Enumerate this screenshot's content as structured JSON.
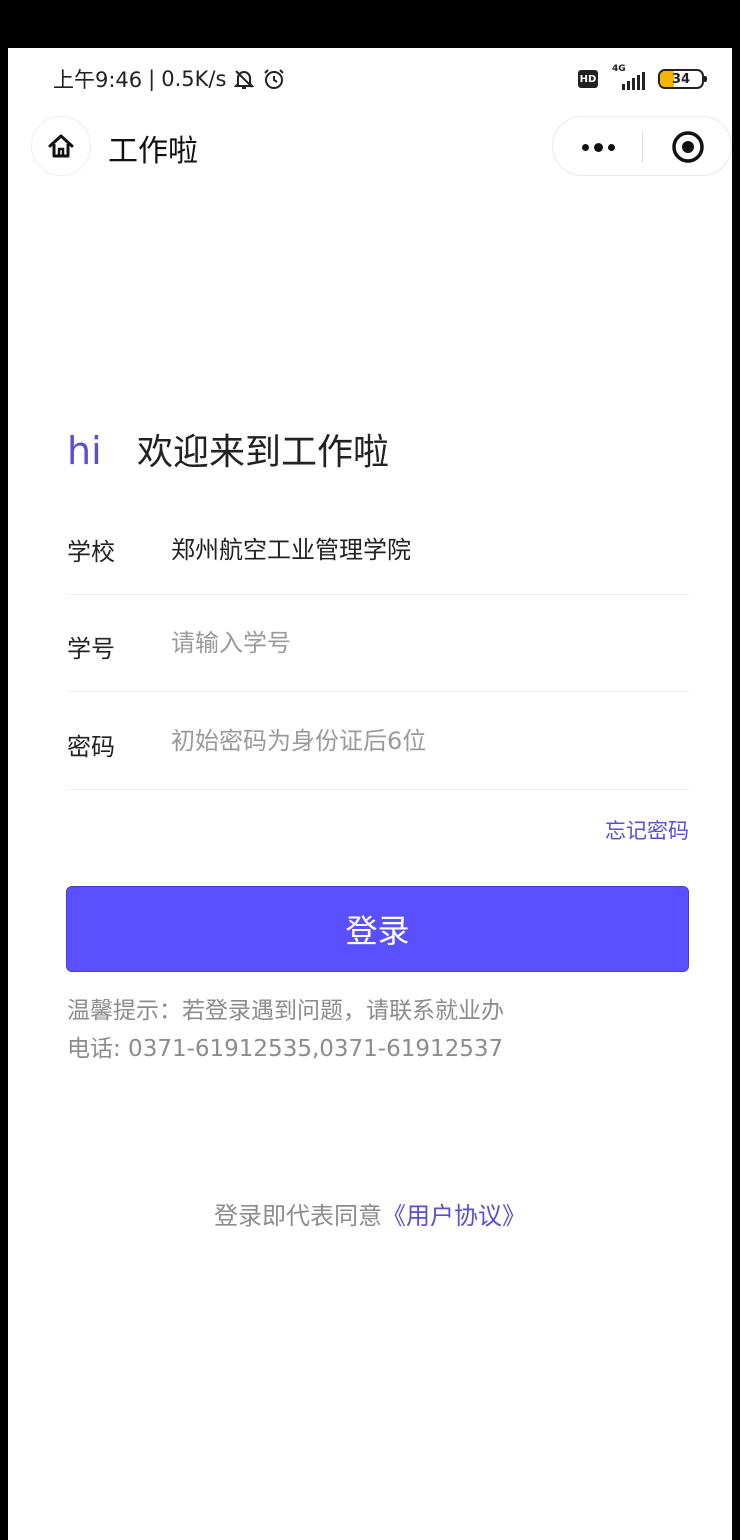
{
  "status_bar": {
    "time": "上午9:46",
    "speed": "0.5K/s",
    "hd": "HD",
    "network": "4G",
    "battery": "34"
  },
  "nav": {
    "title": "工作啦"
  },
  "greeting": {
    "hi": "hi",
    "welcome": "欢迎来到工作啦"
  },
  "form": {
    "school_label": "学校",
    "school_value": "郑州航空工业管理学院",
    "student_id_label": "学号",
    "student_id_placeholder": "请输入学号",
    "password_label": "密码",
    "password_placeholder": "初始密码为身份证后6位"
  },
  "forgot_password": "忘记密码",
  "login_button": "登录",
  "tip": {
    "line1": "温馨提示：若登录遇到问题，请联系就业办",
    "line2": "电话: 0371-61912535,0371-61912537"
  },
  "agreement": {
    "prefix": "登录即代表同意",
    "link": "《用户协议》"
  },
  "colors": {
    "accent": "#5b4fd1",
    "button": "#5b50ff"
  }
}
